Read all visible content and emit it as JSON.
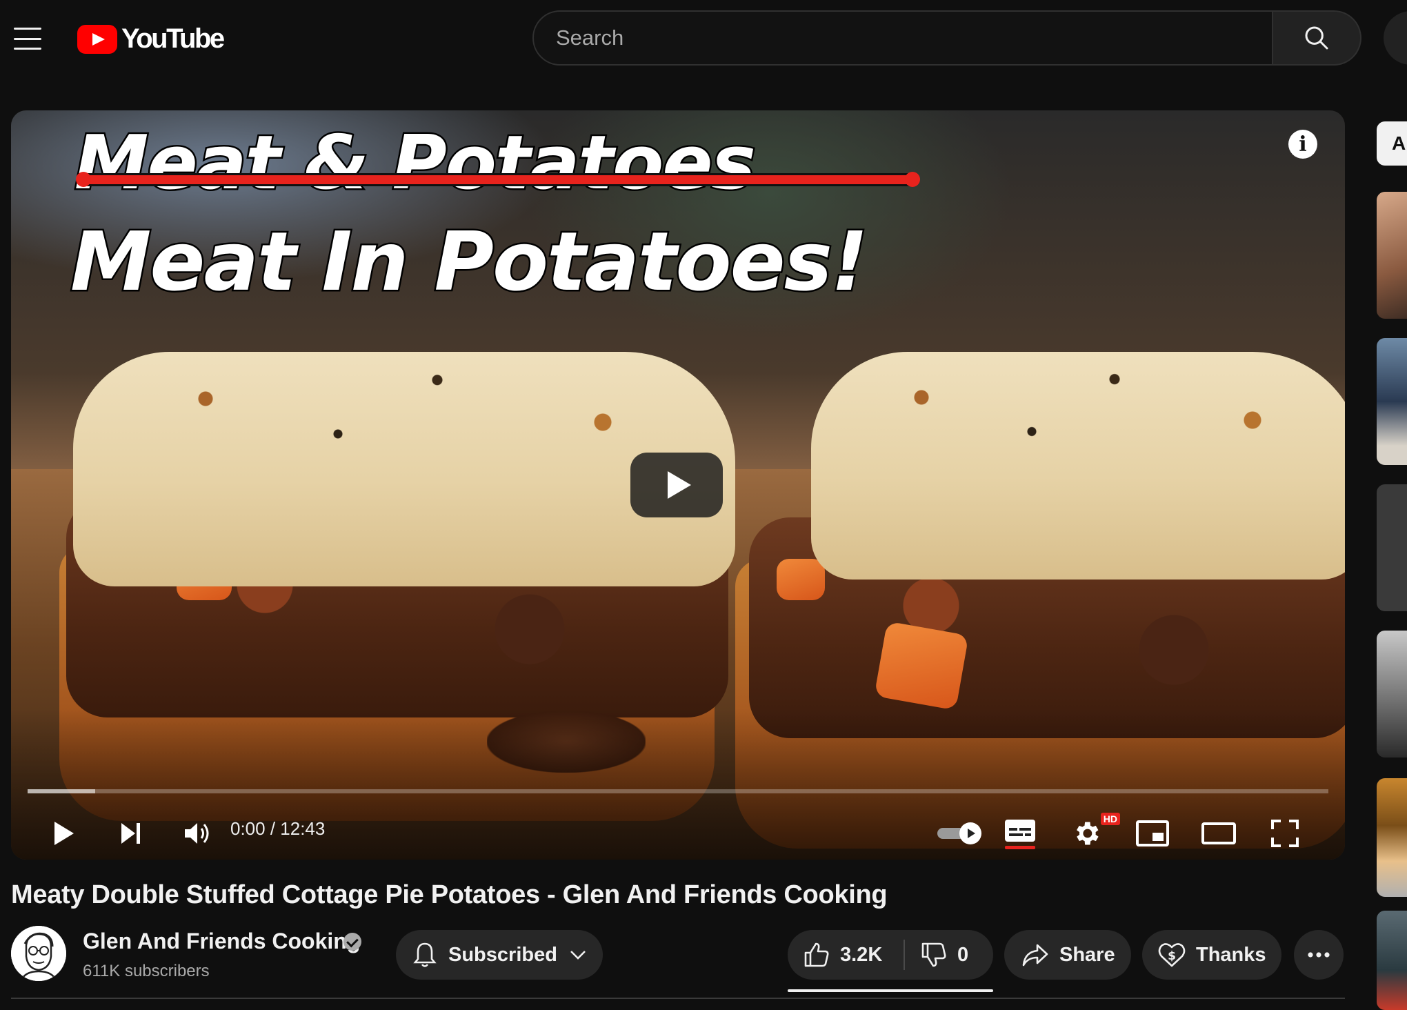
{
  "header": {
    "logo_text": "YouTube",
    "search_placeholder": "Search"
  },
  "player": {
    "thumbnail_line1": "Meat & Potatoes",
    "thumbnail_line2": "Meat In Potatoes!",
    "info_label": "i",
    "current_time": "0:00",
    "duration": "12:43",
    "time_display": "0:00 / 12:43",
    "quality_badge": "HD",
    "loaded_fraction": 0.052,
    "autoplay_on": true
  },
  "video": {
    "title": "Meaty Double Stuffed Cottage Pie Potatoes - Glen And Friends Cooking"
  },
  "channel": {
    "name": "Glen And Friends Cooking",
    "verified": true,
    "subscribers": "611K subscribers"
  },
  "actions": {
    "subscribe_label": "Subscribed",
    "like_count": "3.2K",
    "dislike_count": "0",
    "share_label": "Share",
    "thanks_label": "Thanks"
  },
  "rail": {
    "chip_label": "A"
  },
  "colors": {
    "background": "#0f0f0f",
    "pill": "#272727",
    "brand_red": "#ff0000",
    "strike_red": "#e8231d",
    "text_primary": "#f1f1f1",
    "text_secondary": "#aaaaaa"
  },
  "icons": [
    "menu-icon",
    "youtube-logo-icon",
    "search-icon",
    "info-icon",
    "play-icon",
    "next-icon",
    "volume-icon",
    "autoplay-toggle-icon",
    "captions-icon",
    "settings-icon",
    "miniplayer-icon",
    "theater-icon",
    "fullscreen-icon",
    "bell-icon",
    "chevron-down-icon",
    "thumbs-up-icon",
    "thumbs-down-icon",
    "share-icon",
    "thanks-icon",
    "more-icon",
    "verified-icon"
  ]
}
